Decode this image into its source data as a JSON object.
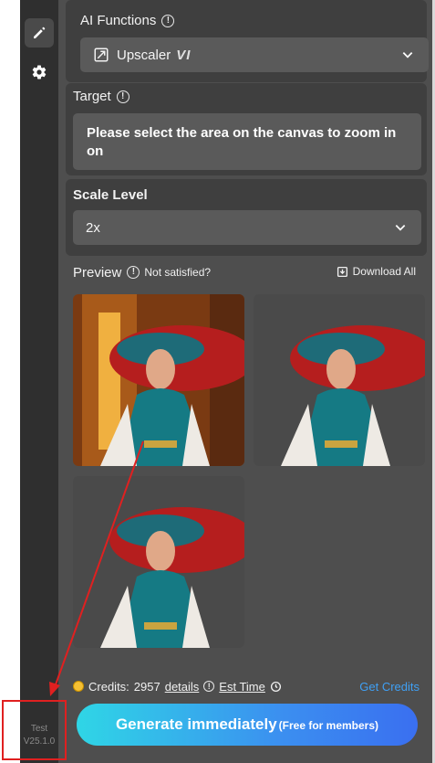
{
  "sidebar": {
    "items": [
      {
        "icon": "pencil-icon",
        "active": true
      },
      {
        "icon": "gear-icon",
        "active": false
      }
    ],
    "env": "Test",
    "version": "V25.1.0"
  },
  "ai_functions": {
    "label": "AI Functions",
    "selected": "Upscaler",
    "badge": "VI"
  },
  "target": {
    "label": "Target",
    "text": "Please select the area on the canvas to zoom in on"
  },
  "scale": {
    "label": "Scale Level",
    "selected": "2x"
  },
  "preview": {
    "label": "Preview",
    "not_satisfied": "Not satisfied?",
    "download_all": "Download All",
    "images": [
      {
        "name": "preview-image-1",
        "background": "#6a3a1a"
      },
      {
        "name": "preview-image-2",
        "background": "#4a4a4a"
      },
      {
        "name": "preview-image-3",
        "background": "#4a4a4a"
      }
    ]
  },
  "footer": {
    "credits_label": "Credits:",
    "credits_value": "2957",
    "details": "details",
    "est_time": "Est Time",
    "get_credits": "Get Credits",
    "generate_main": "Generate immediately",
    "generate_sub": "(Free for members)"
  },
  "colors": {
    "accent_blue": "#3fa0f5",
    "annotation_red": "#e02020",
    "button_gradient_start": "#2fd6e6",
    "button_gradient_end": "#3a6ff0"
  }
}
